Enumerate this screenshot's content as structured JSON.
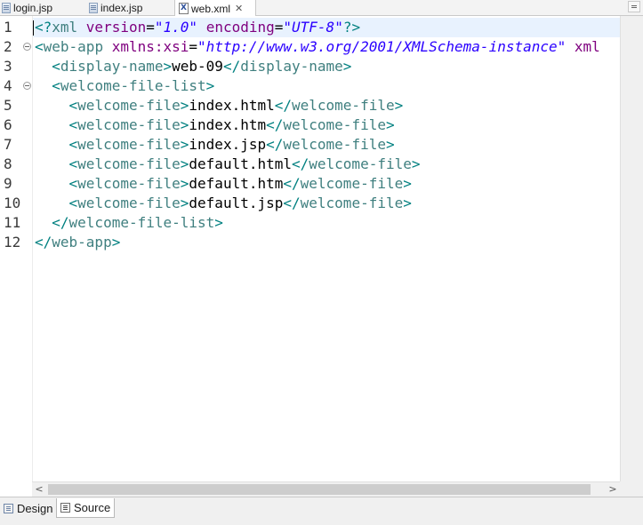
{
  "tabs": [
    {
      "label": "login.jsp",
      "icon": "jsp-file-icon",
      "active": false
    },
    {
      "label": "index.jsp",
      "icon": "jsp-file-icon",
      "active": false
    },
    {
      "label": "web.xml",
      "icon": "xml-file-icon",
      "active": true,
      "close": "✕"
    }
  ],
  "editor": {
    "line_numbers": [
      "1",
      "2",
      "3",
      "4",
      "5",
      "6",
      "7",
      "8",
      "9",
      "10",
      "11",
      "12"
    ],
    "lines": [
      [
        {
          "t": "<?",
          "c": "bracket"
        },
        {
          "t": "xml ",
          "c": "tag"
        },
        {
          "t": "version",
          "c": "attr"
        },
        {
          "t": "=",
          "c": "eq"
        },
        {
          "t": "\"1.0\"",
          "c": "val"
        },
        {
          "t": " ",
          "c": "text"
        },
        {
          "t": "encoding",
          "c": "attr"
        },
        {
          "t": "=",
          "c": "eq"
        },
        {
          "t": "\"UTF-8\"",
          "c": "val"
        },
        {
          "t": "?>",
          "c": "bracket"
        }
      ],
      [
        {
          "t": "<",
          "c": "bracket"
        },
        {
          "t": "web-app ",
          "c": "tag"
        },
        {
          "t": "xmlns:xsi",
          "c": "attr"
        },
        {
          "t": "=",
          "c": "eq"
        },
        {
          "t": "\"http://www.w3.org/2001/XMLSchema-instance\"",
          "c": "val"
        },
        {
          "t": " ",
          "c": "text"
        },
        {
          "t": "xml",
          "c": "attr"
        }
      ],
      [
        {
          "t": "  <",
          "c": "bracket"
        },
        {
          "t": "display-name",
          "c": "tag"
        },
        {
          "t": ">",
          "c": "bracket"
        },
        {
          "t": "web-09",
          "c": "text"
        },
        {
          "t": "</",
          "c": "bracket"
        },
        {
          "t": "display-name",
          "c": "tag"
        },
        {
          "t": ">",
          "c": "bracket"
        }
      ],
      [
        {
          "t": "  <",
          "c": "bracket"
        },
        {
          "t": "welcome-file-list",
          "c": "tag"
        },
        {
          "t": ">",
          "c": "bracket"
        }
      ],
      [
        {
          "t": "    <",
          "c": "bracket"
        },
        {
          "t": "welcome-file",
          "c": "tag"
        },
        {
          "t": ">",
          "c": "bracket"
        },
        {
          "t": "index.html",
          "c": "text"
        },
        {
          "t": "</",
          "c": "bracket"
        },
        {
          "t": "welcome-file",
          "c": "tag"
        },
        {
          "t": ">",
          "c": "bracket"
        }
      ],
      [
        {
          "t": "    <",
          "c": "bracket"
        },
        {
          "t": "welcome-file",
          "c": "tag"
        },
        {
          "t": ">",
          "c": "bracket"
        },
        {
          "t": "index.htm",
          "c": "text"
        },
        {
          "t": "</",
          "c": "bracket"
        },
        {
          "t": "welcome-file",
          "c": "tag"
        },
        {
          "t": ">",
          "c": "bracket"
        }
      ],
      [
        {
          "t": "    <",
          "c": "bracket"
        },
        {
          "t": "welcome-file",
          "c": "tag"
        },
        {
          "t": ">",
          "c": "bracket"
        },
        {
          "t": "index.jsp",
          "c": "text"
        },
        {
          "t": "</",
          "c": "bracket"
        },
        {
          "t": "welcome-file",
          "c": "tag"
        },
        {
          "t": ">",
          "c": "bracket"
        }
      ],
      [
        {
          "t": "    <",
          "c": "bracket"
        },
        {
          "t": "welcome-file",
          "c": "tag"
        },
        {
          "t": ">",
          "c": "bracket"
        },
        {
          "t": "default.html",
          "c": "text"
        },
        {
          "t": "</",
          "c": "bracket"
        },
        {
          "t": "welcome-file",
          "c": "tag"
        },
        {
          "t": ">",
          "c": "bracket"
        }
      ],
      [
        {
          "t": "    <",
          "c": "bracket"
        },
        {
          "t": "welcome-file",
          "c": "tag"
        },
        {
          "t": ">",
          "c": "bracket"
        },
        {
          "t": "default.htm",
          "c": "text"
        },
        {
          "t": "</",
          "c": "bracket"
        },
        {
          "t": "welcome-file",
          "c": "tag"
        },
        {
          "t": ">",
          "c": "bracket"
        }
      ],
      [
        {
          "t": "    <",
          "c": "bracket"
        },
        {
          "t": "welcome-file",
          "c": "tag"
        },
        {
          "t": ">",
          "c": "bracket"
        },
        {
          "t": "default.jsp",
          "c": "text"
        },
        {
          "t": "</",
          "c": "bracket"
        },
        {
          "t": "welcome-file",
          "c": "tag"
        },
        {
          "t": ">",
          "c": "bracket"
        }
      ],
      [
        {
          "t": "  </",
          "c": "bracket"
        },
        {
          "t": "welcome-file-list",
          "c": "tag"
        },
        {
          "t": ">",
          "c": "bracket"
        }
      ],
      [
        {
          "t": "</",
          "c": "bracket"
        },
        {
          "t": "web-app",
          "c": "tag"
        },
        {
          "t": ">",
          "c": "bracket"
        }
      ]
    ],
    "foldable_lines": [
      2,
      4
    ],
    "current_line": 1
  },
  "scrollbar": {
    "left_arrow": "<",
    "right_arrow": ">"
  },
  "bottom_tabs": [
    {
      "label": "Design",
      "icon": "design-icon",
      "active": false
    },
    {
      "label": "Source",
      "icon": "source-icon",
      "active": true
    }
  ],
  "colors": {
    "bracket": "#008080",
    "tag": "#3f7f7f",
    "attr": "#7f007f",
    "value": "#2a00ff",
    "current_line_bg": "#e8f2fe"
  }
}
